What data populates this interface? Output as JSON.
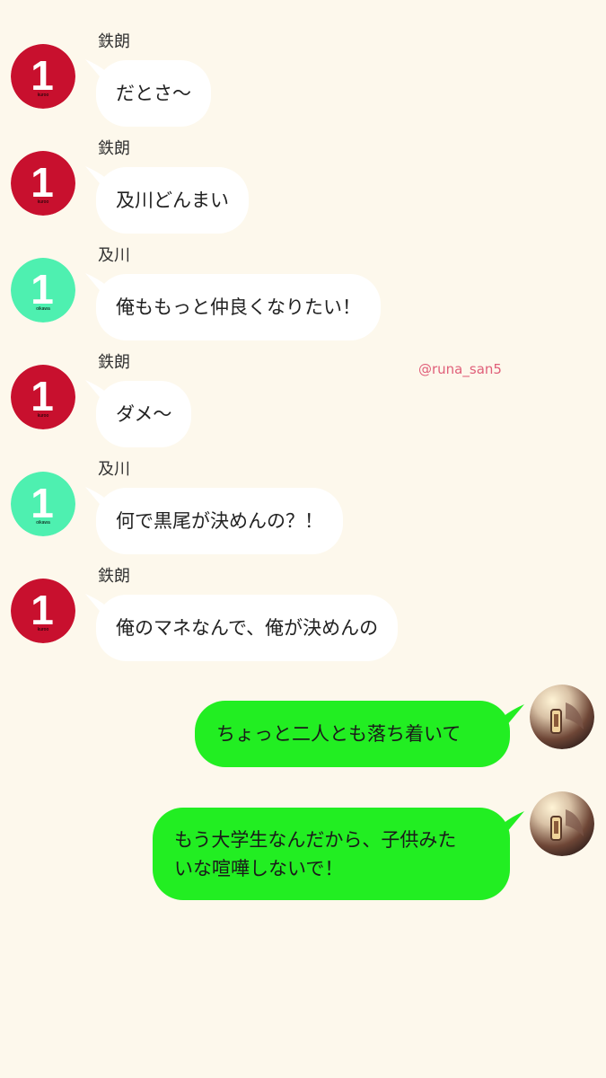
{
  "colors": {
    "background": "#fdf8ec",
    "kuroo_avatar": "#c8102e",
    "oikawa_avatar": "#4ef0b0",
    "incoming_bubble": "#ffffff",
    "outgoing_bubble": "#22ee22",
    "watermark": "#e0607a"
  },
  "watermark": "@runa_san5",
  "avatars": {
    "kuroo": {
      "badge": "1",
      "caption": "kuroo"
    },
    "oikawa": {
      "badge": "1",
      "caption": "oikawa"
    }
  },
  "messages": [
    {
      "sender": "鉄朗",
      "text": "だとさ〜"
    },
    {
      "sender": "鉄朗",
      "text": "及川どんまい"
    },
    {
      "sender": "及川",
      "text": "俺ももっと仲良くなりたい！"
    },
    {
      "sender": "鉄朗",
      "text": "ダメ〜"
    },
    {
      "sender": "及川",
      "text": "何で黒尾が決めんの？！"
    },
    {
      "sender": "鉄朗",
      "text": "俺のマネなんで、俺が決めんの"
    }
  ],
  "my_messages": [
    {
      "text": "ちょっと二人とも落ち着いて"
    },
    {
      "line1": "もう大学生なんだから、子供みた",
      "line2": "いな喧嘩しないで！"
    }
  ]
}
